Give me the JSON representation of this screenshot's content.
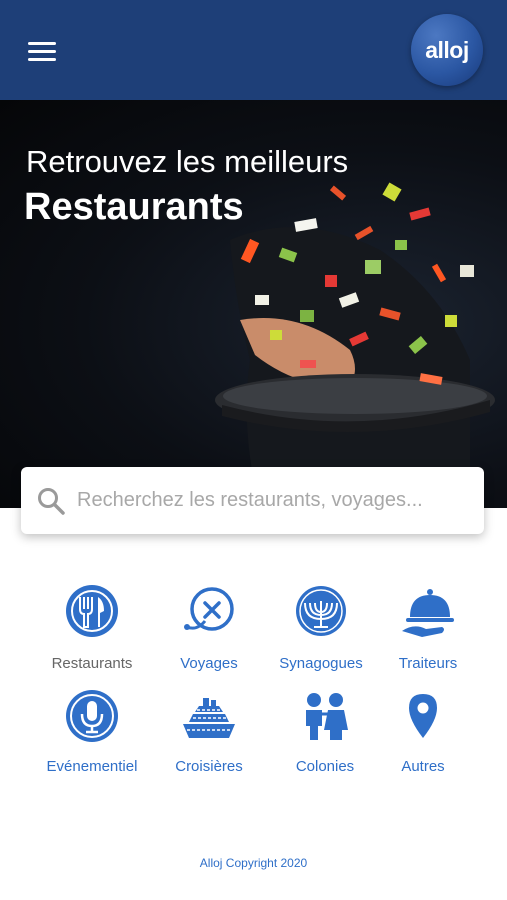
{
  "header": {
    "menu_icon": "hamburger-menu-icon",
    "logo_text": "alloj",
    "brand_color": "#1e3f78"
  },
  "hero": {
    "line1": "Retrouvez les meilleurs",
    "line2": "Restaurants"
  },
  "search": {
    "placeholder": "Recherchez les restaurants, voyages..."
  },
  "categories": [
    {
      "label": "Restaurants",
      "icon": "fork-knife-plate-icon"
    },
    {
      "label": "Voyages",
      "icon": "airplane-icon"
    },
    {
      "label": "Synagogues",
      "icon": "menorah-icon"
    },
    {
      "label": "Traiteurs",
      "icon": "cloche-icon"
    },
    {
      "label": "Evénementiel",
      "icon": "microphone-icon"
    },
    {
      "label": "Croisières",
      "icon": "cruise-ship-icon"
    },
    {
      "label": "Colonies",
      "icon": "children-icon"
    },
    {
      "label": "Autres",
      "icon": "map-pin-icon"
    }
  ],
  "accent_color": "#2f6fc8",
  "footer": {
    "copyright": "Alloj Copyright 2020"
  }
}
